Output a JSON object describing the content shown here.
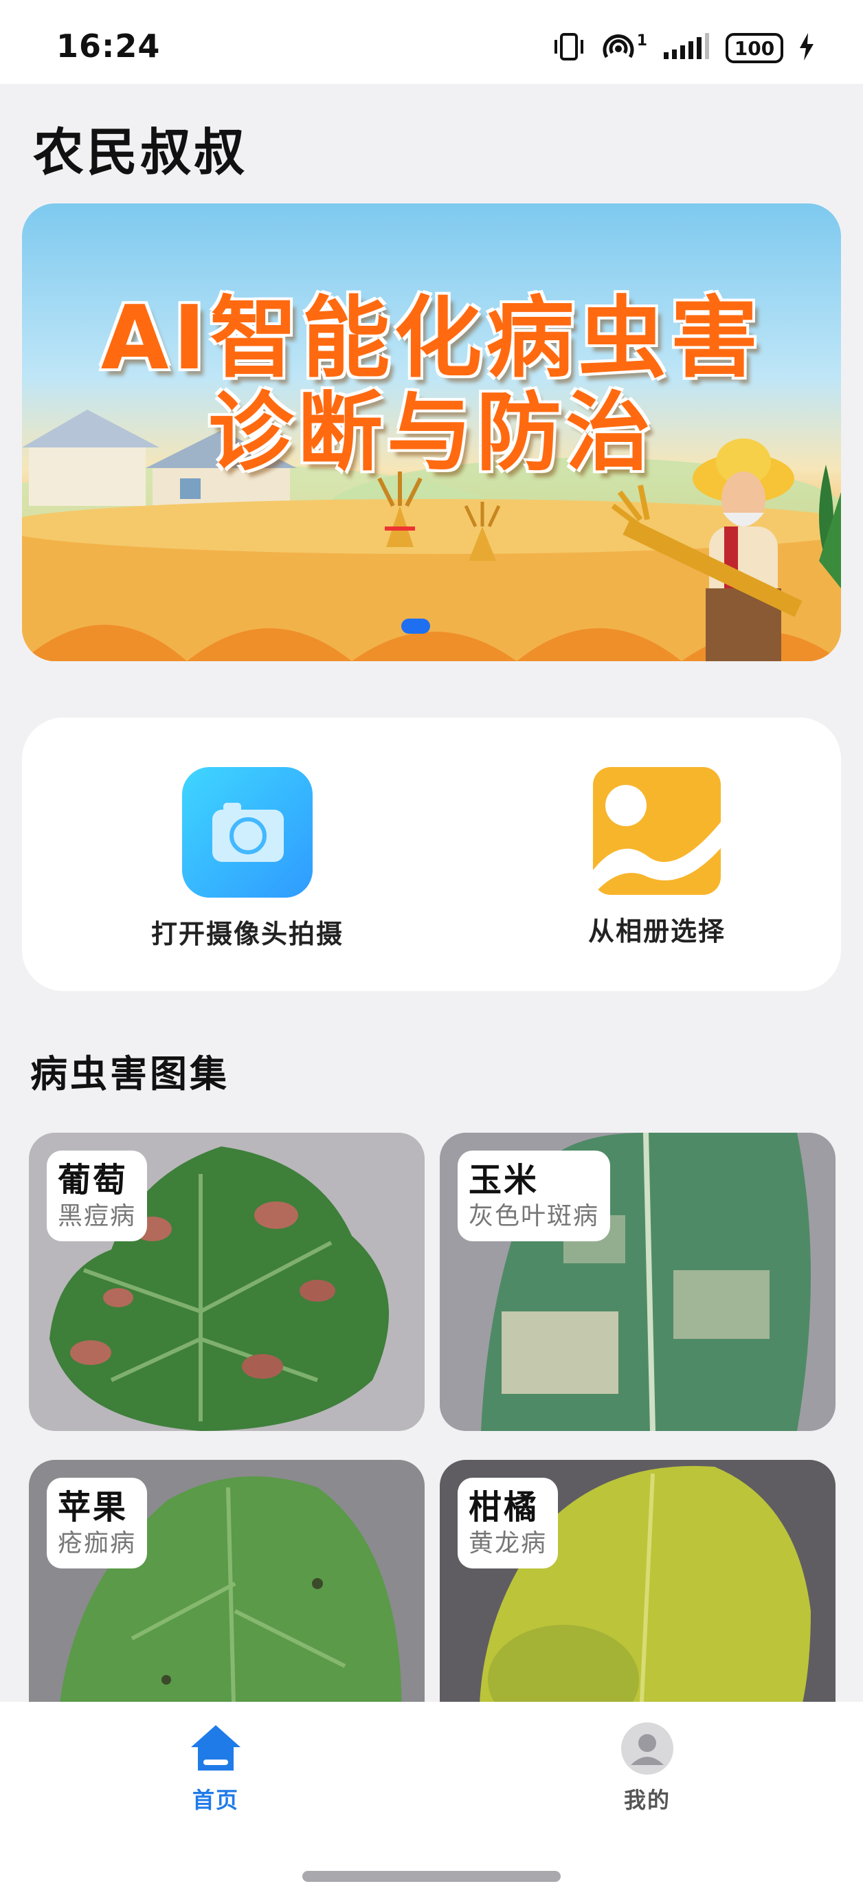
{
  "status_bar": {
    "time": "16:24",
    "network_sup": "1",
    "battery": "100"
  },
  "app": {
    "title": "农民叔叔"
  },
  "banner": {
    "line1": "AI智能化病虫害",
    "line2": "诊断与防治"
  },
  "actions": {
    "camera_label": "打开摄像头拍摄",
    "album_label": "从相册选择"
  },
  "gallery": {
    "title": "病虫害图集",
    "items": [
      {
        "name": "葡萄",
        "disease": "黑痘病"
      },
      {
        "name": "玉米",
        "disease": "灰色叶斑病"
      },
      {
        "name": "苹果",
        "disease": "疮痂病"
      },
      {
        "name": "柑橘",
        "disease": "黄龙病"
      }
    ]
  },
  "nav": {
    "home_label": "首页",
    "me_label": "我的"
  },
  "colors": {
    "accent": "#1f7be8",
    "camera": "#2f9bff",
    "album": "#f7b52c",
    "banner_text": "#ff6a10"
  }
}
